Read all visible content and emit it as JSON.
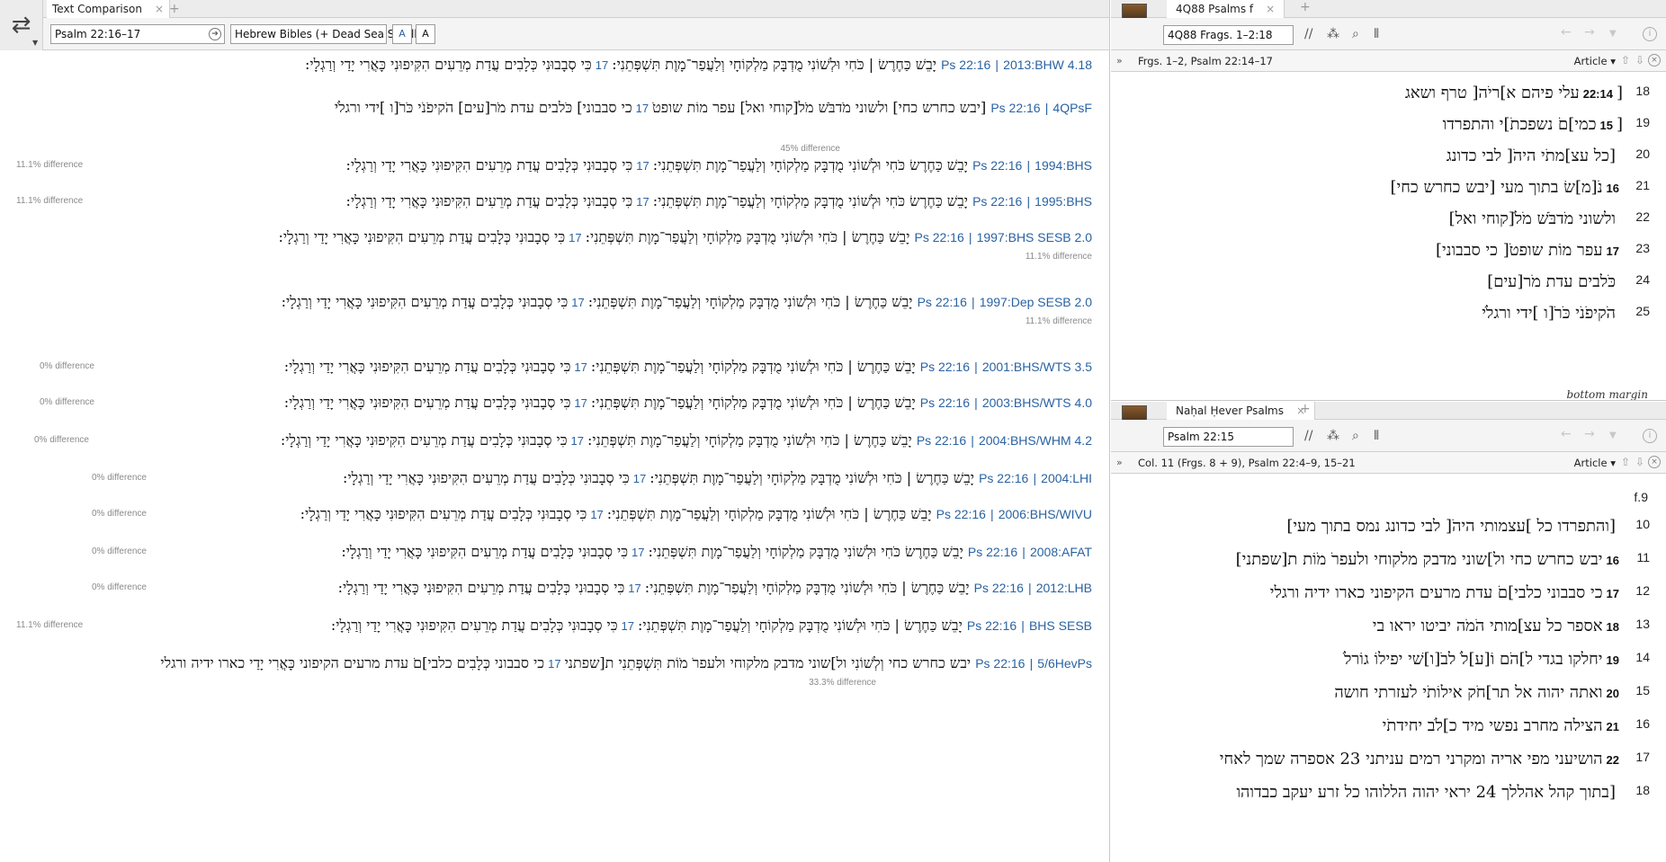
{
  "left": {
    "tab": "Text Comparison",
    "reference": "Psalm 22:16–17",
    "collection": "Hebrew Bibles (+ Dead Sea Scrolls)",
    "btn1": "A",
    "btn2": "A",
    "rows": [
      {
        "label": "2013:BHW 4.18",
        "ref": "Ps 22:16",
        "a": "יָבֵשׁ כַּחֶרֶשׂ | כֹּחִי וּלְשׁוֹנִי מֻדְבָּק מַלְקוֹחָי וְלַעֲפַר־מָוֶת תִּשְׁפְּתֵנִי:",
        "v": "17",
        "b": "כִּי סְבָבוּנִי כְּלָבִים עֲדַת מְרֵעִים הִקִּיפוּנִי כָּאֲרִי יָדַי וְרַגְלָי:",
        "diff": ""
      },
      {
        "label": "4QPsF",
        "ref": "Ps 22:16",
        "a": "[יבש כחרש כחי] ולשוני מֹדבֹּשׁ מֹלֹ[קוחי ואל] עפר מוֹת שופטֹ",
        "v": "17",
        "b": "כי סבבוני] כֹּלבים עדת מֹר[עים] הֹקיפֹנֹי כֹּרֹ[ו ]ידי ורגלֹי",
        "diff": "45% difference"
      },
      {
        "label": "1994:BHS",
        "ref": "Ps 22:16",
        "a": "יָבֵשׁ כַּחֶרֶשׂ כֹּחִי וּלְשׁוֹנִי מֻדְבָּק מַלְקוֹחָי וְלַעֲפַר־מָוֶת תִּשְׁפְּתֵנִי:",
        "v": "17",
        "b": "כִּי סְבָבוּנִי כְּלָבִים עֲדַת מְרֵעִים הִקִּיפוּנִי כָּאֲרִי יָדַי וְרַגְלָי:",
        "diff": "11.1% difference"
      },
      {
        "label": "1995:BHS",
        "ref": "Ps 22:16",
        "a": "יָבֵשׁ כַּחֶרֶשׂ כֹּחִי וּלְשׁוֹנִי מֻדְבָּק מַלְקוֹחָי וְלַעֲפַר־מָוֶת תִּשְׁפְּתֵנִי:",
        "v": "17",
        "b": "כִּי סְבָבוּנִי כְּלָבִים עֲדַת מְרֵעִים הִקִּיפוּנִי כָּאֲרִי יָדַי וְרַגְלָי:",
        "diff": "11.1% difference"
      },
      {
        "label": "1997:BHS SESB 2.0",
        "ref": "Ps 22:16",
        "a": "יָבֵשׁ כַּחֶרֶשׂ | כֹּחִי וּלְשׁוֹנִי מֻדְבָּק מַלְקוֹחָי וְלַעֲפַר־מָוֶת תִּשְׁפְּתֵנִי:",
        "v": "17",
        "b": "כִּי סְבָבוּנִי כְּלָבִים עֲדַת מְרֵעִים הִקִּיפוּנִי כָּאֲרִי יָדַי וְרַגְלָי:",
        "diff": "11.1% difference"
      },
      {
        "label": "1997:Dep SESB 2.0",
        "ref": "Ps 22:16",
        "a": "יָבֵשׁ כַּחֶרֶשׂ | כֹּחִי וּלְשׁוֹנִי מֻדְבָּק מַלְקוֹחָי וְלַעֲפַר־מָוֶת תִּשְׁפְּתֵנִי:",
        "v": "17",
        "b": "כִּי סְבָבוּנִי כְּלָבִים עֲדַת מְרֵעִים הִקִּיפוּנִי כָּאֲרִי יָדַי וְרַגְלָי:",
        "diff": "11.1% difference"
      },
      {
        "label": "2001:BHS/WTS 3.5",
        "ref": "Ps 22:16",
        "a": "יָבֵשׁ כַּחֶרֶשׂ | כֹּחִי וּלְשׁוֹנִי מֻדְבָּק מַלְקוֹחָי וְלַעֲפַר־מָוֶת תִּשְׁפְּתֵנִי:",
        "v": "17",
        "b": "כִּי סְבָבוּנִי כְּלָבִים עֲדַת מְרֵעִים הִקִּיפוּנִי כָּאֲרִי יָדַי וְרַגְלָי:",
        "diff": "0% difference"
      },
      {
        "label": "2003:BHS/WTS 4.0",
        "ref": "Ps 22:16",
        "a": "יָבֵשׁ כַּחֶרֶשׂ | כֹּחִי וּלְשׁוֹנִי מֻדְבָּק מַלְקוֹחָי וְלַעֲפַר־מָוֶת תִּשְׁפְּתֵנִי:",
        "v": "17",
        "b": "כִּי סְבָבוּנִי כְּלָבִים עֲדַת מְרֵעִים הִקִּיפוּנִי כָּאֲרִי יָדַי וְרַגְלָי:",
        "diff": "0% difference"
      },
      {
        "label": "2004:BHS/WHM 4.2",
        "ref": "Ps 22:16",
        "a": "יָבֵשׁ כַּחֶרֶשׂ | כֹּחִי וּלְשׁוֹנִי מֻדְבָּק מַלְקוֹחָי וְלַעֲפַר־מָוֶת תִּשְׁפְּתֵנִי:",
        "v": "17",
        "b": "כִּי סְבָבוּנִי כְּלָבִים עֲדַת מְרֵעִים הִקִּיפוּנִי כָּאֲרִי יָדַי וְרַגְלָי:",
        "diff": "0% difference"
      },
      {
        "label": "2004:LHI",
        "ref": "Ps 22:16",
        "a": "יָבֵשׁ כַּחֶרֶשׂ | כֹּחִי וּלְשׁוֹנִי מֻדְבָּק מַלְקוֹחָי וְלַעֲפַר־מָוֶת תִּשְׁפְּתֵנִי:",
        "v": "17",
        "b": "כִּי סְבָבוּנִי כְּלָבִים עֲדַת מְרֵעִים הִקִּיפוּנִי כָּאֲרִי יָדַי וְרַגְלָי:",
        "diff": "0% difference"
      },
      {
        "label": "2006:BHS/WIVU",
        "ref": "Ps 22:16",
        "a": "יָבֵשׁ כַּחֶרֶשׂ | כֹּחִי וּלְשׁוֹנִי מֻדְבָּק מַלְקוֹחָי וְלַעֲפַר־מָוֶת תִּשְׁפְּתֵנִי:",
        "v": "17",
        "b": "כִּי סְבָבוּנִי כְּלָבִים עֲדַת מְרֵעִים הִקִּיפוּנִי כָּאֲרִי יָדַי וְרַגְלָי:",
        "diff": "0% difference"
      },
      {
        "label": "2008:AFAT",
        "ref": "Ps 22:16",
        "a": "יָבֵשׁ כַּחֶרֶשׂ כֹּחִי וּלְשׁוֹנִי מֻדְבָּק מַלְקוֹחָי וְלַעֲפַר־מָוֶת תִּשְׁפְּתֵנִי:",
        "v": "17",
        "b": "כִּי סְבָבוּנִי כְּלָבִים עֲדַת מְרֵעִים הִקִּיפוּנִי כָּאֲרִי יָדַי וְרַגְלָי:",
        "diff": "0% difference"
      },
      {
        "label": "2012:LHB",
        "ref": "Ps 22:16",
        "a": "יָבֵשׁ כַּחֶרֶשׂ | כֹּחִי וּלְשׁוֹנִי מֻדְבָּק מַלְקוֹחָי וְלַעֲפַר־מָוֶת תִּשְׁפְּתֵנִי:",
        "v": "17",
        "b": "כִּי סְבָבוּנִי כְּלָבִים עֲדַת מְרֵעִים הִקִּיפוּנִי כָּאֲרִי יָדַי וְרַגְלָי:",
        "diff": "0% difference"
      },
      {
        "label": "BHS SESB",
        "ref": "Ps 22:16",
        "a": "יָבֵשׁ כַּחֶרֶשׂ | כֹּחִי וּלְשׁוֹנִי מֻדְבָּק מַלְקוֹחָי וְלַעֲפַר־מָוֶת תִּשְׁפְּתֵנִי:",
        "v": "17",
        "b": "כִּי סְבָבוּנִי כְּלָבִים עֲדַת מְרֵעִים הִקִּיפוּנִי כָּאֲרִי יָדַי וְרַגְלָי:",
        "diff": "11.1% difference"
      },
      {
        "label": "5/6HevPs",
        "ref": "Ps 22:16",
        "a": "יבש כחרש כחי וְלְשׁוֹנִי ול]שוני מדבק מלקוחי ולעפרֹ מֹוֹת תִּשְׁפְּתֵנִי ת[שפתני",
        "v": "17",
        "b": "כי סבבוני כְּלָבִים כלבי]םֹ עדת מרעים הקיפוני כָּאֲרִי יָדַי כארו ידיה ורגלי",
        "diff": "33.3% difference"
      }
    ]
  },
  "top_right": {
    "tab": "4Q88 Psalms f",
    "reference": "4Q88 Frags. 1–2:18",
    "location": "Frgs. 1–2, Psalm 22:14–17",
    "article": "Article",
    "lines": [
      {
        "n": "18",
        "pre": "[",
        "v": "22:14",
        "t": "עלי פיהם א]ריֹה[ טרף ושאג"
      },
      {
        "n": "19",
        "pre": "[",
        "v": "15",
        "t": "כמי]םֹ נשפכתֹ]י והתפרדו"
      },
      {
        "n": "20",
        "pre": "",
        "v": "",
        "t": "[כל עצ]מתֹי היהֹ[ לבי כדונג"
      },
      {
        "n": "21",
        "pre": "",
        "v": "16",
        "t": "נֹ[מ]שׂ בתוך מעי [יבש כחרש כחי]"
      },
      {
        "n": "22",
        "pre": "",
        "v": "",
        "t": "ולשוני מֹדבֹּשׁ מֹלֹ[קוחי ואל]"
      },
      {
        "n": "23",
        "pre": "",
        "v": "17",
        "t": "עפר מוֹת שופטֹ[ כי סבבוני]"
      },
      {
        "n": "24",
        "pre": "",
        "v": "",
        "t": "כֹּלבים עדת מֹר[עים]"
      },
      {
        "n": "25",
        "pre": "",
        "v": "",
        "t": "הֹקיפֹנֹי כֹּרֹ[ו ]ידי ורגלֹי"
      }
    ],
    "bottom_margin": "bottom margin"
  },
  "bottom_right": {
    "tab": "Naḥal Ḥever Psalms",
    "reference": "Psalm 22:15",
    "location": "Col. 11 (Frgs. 8 + 9), Psalm 22:4–9, 15–21",
    "article": "Article",
    "frag_label": "f.9",
    "lines": [
      {
        "n": "10",
        "v": "",
        "t": "[והתפרדו כל ]עצמותי היהֹ[ לבי כדונג נמס בתוך מעי]"
      },
      {
        "n": "11",
        "v": "16",
        "t": "יבש כחרש כחי ול]שוני מדבק מלקוחי ולעפרֹ מֹוֹת ת[שפתני]"
      },
      {
        "n": "12",
        "v": "17",
        "t": "כי סבבוני כלבי]םֹ עדת מרעים הקיפוני כארו ידיה ורגלי"
      },
      {
        "n": "13",
        "v": "18",
        "t": "אספר כל עצ]מותי הֹמֹה יביטו יראו בי"
      },
      {
        "n": "14",
        "v": "19",
        "t": "יחלקו בגדי ל]הֹם וֹ[ע]לֹ לבֹ[ו]שׁי יפילוֹ גוֹרלֹ"
      },
      {
        "n": "15",
        "v": "20",
        "t": "ואתה יהוה אל תר]חֹק אילוֹתֹי לעזרתי חושה"
      },
      {
        "n": "16",
        "v": "21",
        "t": "הצילה מחרב נפשי מיד כ]לֹב יחידתֹי"
      },
      {
        "n": "17",
        "v": "22",
        "t": "הושיעני מפי אריה ומקרני רמים עניתני 23 אספרה שמך לאחי"
      },
      {
        "n": "18",
        "v": "",
        "t": "[בתוך קהל אהללך 24 יראי יהוה הללוהו כל זרע יעקב כבדוהו"
      }
    ]
  }
}
